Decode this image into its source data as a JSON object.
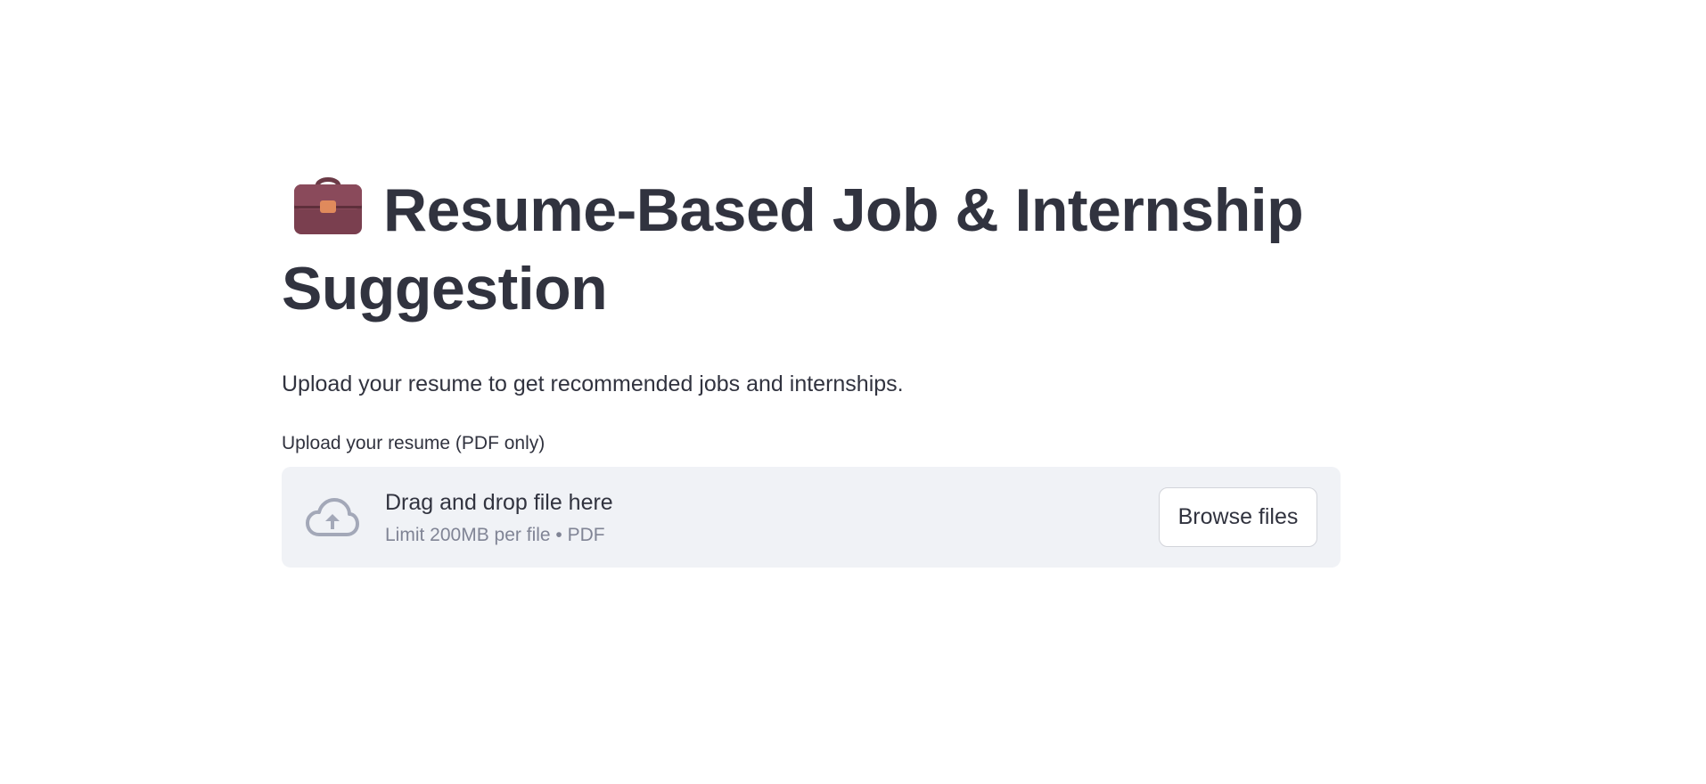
{
  "page": {
    "title": "Resume-Based Job & Internship Suggestion",
    "title_icon": "briefcase-icon",
    "subtitle": "Upload your resume to get recommended jobs and internships."
  },
  "uploader": {
    "label": "Upload your resume (PDF only)",
    "drop_text": "Drag and drop file here",
    "limit_text": "Limit 200MB per file • PDF",
    "browse_label": "Browse files",
    "icon": "cloud-upload-icon"
  },
  "colors": {
    "text": "#31333f",
    "muted": "#808495",
    "dropzone_bg": "#f0f2f6",
    "icon": "#a3a8b8",
    "briefcase": "#7a3f4f",
    "briefcase_clasp": "#e08a5c"
  }
}
